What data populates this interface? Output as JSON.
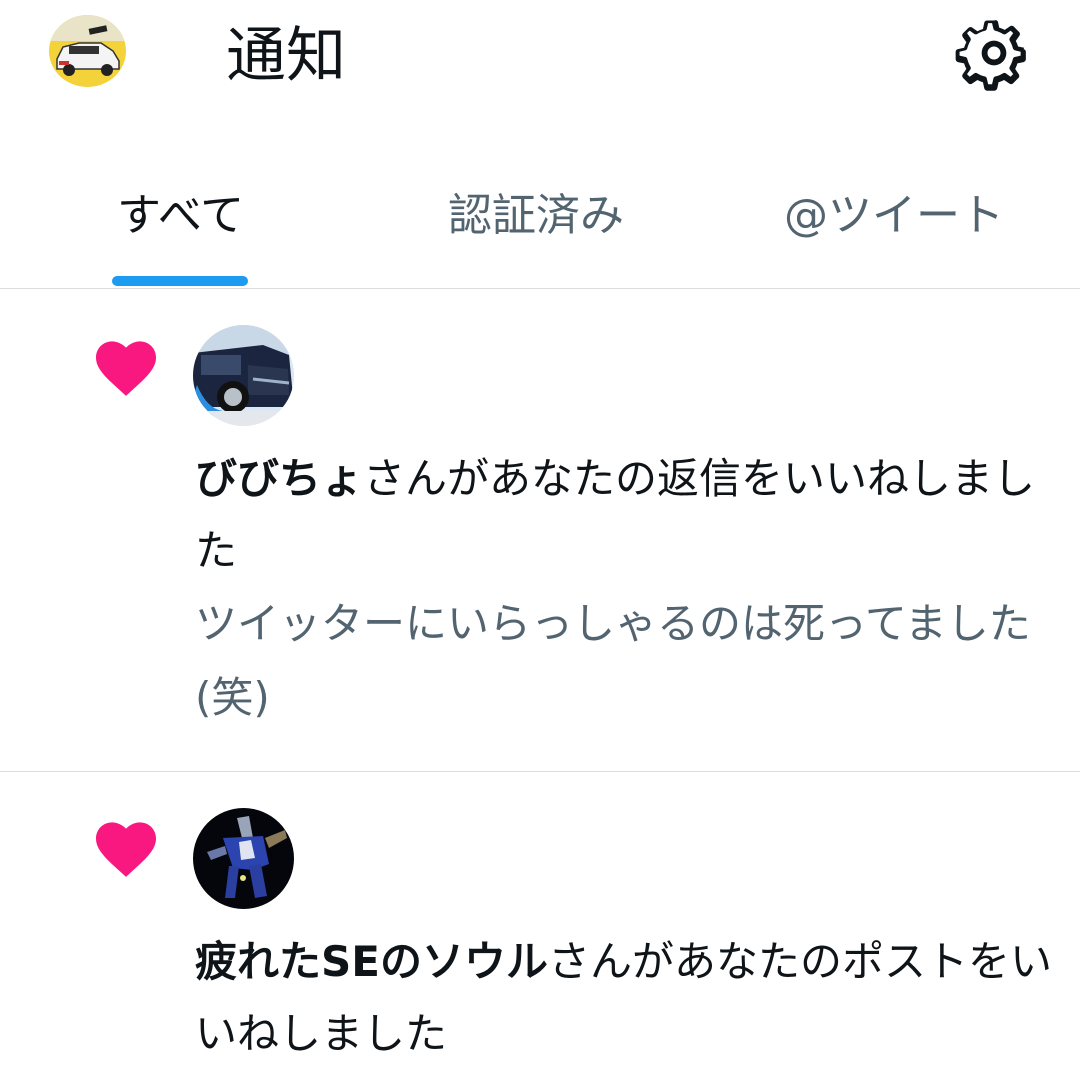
{
  "header": {
    "title": "通知",
    "avatar_icon": "profile-avatar-car",
    "settings_icon": "gear-icon"
  },
  "tabs": [
    {
      "label": "すべて",
      "selected": true
    },
    {
      "label": "認証済み",
      "selected": false
    },
    {
      "label": "@ツイート",
      "selected": false
    }
  ],
  "colors": {
    "accent": "#1d9bf0",
    "like": "#f91880",
    "secondary_text": "#536471",
    "divider": "#d9dde0"
  },
  "notifications": [
    {
      "type": "like",
      "icon": "heart-icon",
      "user_name": "びびちょ",
      "action_text": "さんがあなたの返信をいいねしました",
      "preview": "ツイッターにいらっしゃるのは死ってました(笑)"
    },
    {
      "type": "like",
      "icon": "heart-icon",
      "user_name": "疲れたSEのソウル",
      "action_text": "さんがあなたのポストをいいねしました"
    }
  ]
}
